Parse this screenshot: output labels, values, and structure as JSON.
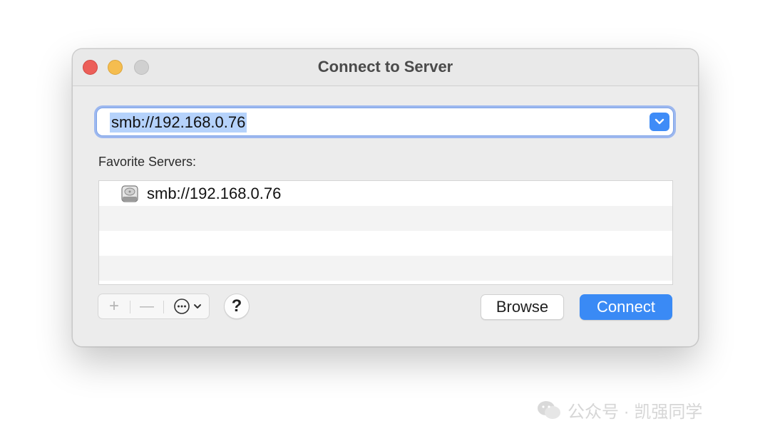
{
  "window": {
    "title": "Connect to Server"
  },
  "server_address": {
    "value": "smb://192.168.0.76"
  },
  "favorites": {
    "label": "Favorite Servers:",
    "items": [
      {
        "address": "smb://192.168.0.76",
        "icon": "network-drive-icon"
      }
    ]
  },
  "toolbar": {
    "add_label": "+",
    "remove_label": "—",
    "help_label": "?"
  },
  "buttons": {
    "browse_label": "Browse",
    "connect_label": "Connect"
  },
  "watermark": {
    "text": "公众号 · 凯强同学"
  },
  "colors": {
    "accent": "#3a8af5",
    "selection": "#b5d2fb",
    "close": "#ec5f59",
    "minimize": "#f5bd4f",
    "zoom": "#d0d0d0"
  }
}
